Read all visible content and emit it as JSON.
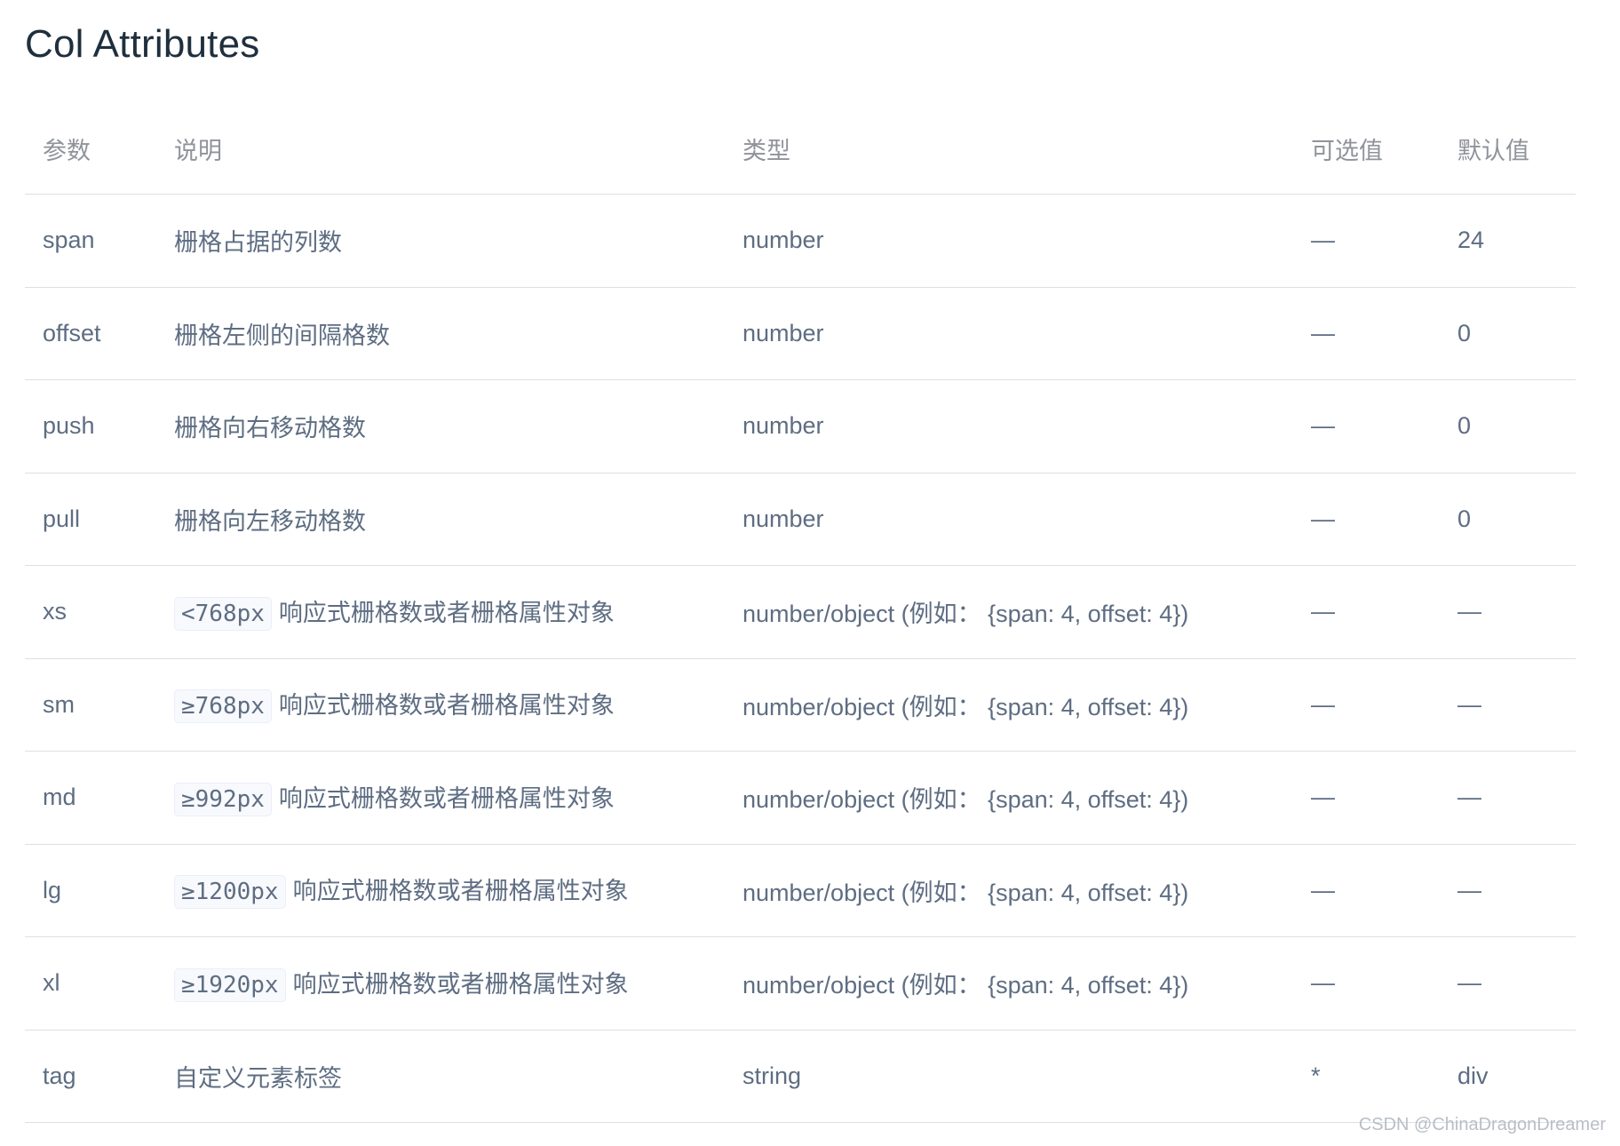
{
  "title": "Col Attributes",
  "table": {
    "headers": [
      "参数",
      "说明",
      "类型",
      "可选值",
      "默认值"
    ],
    "rows": [
      {
        "param": "span",
        "badge": "",
        "desc": "栅格占据的列数",
        "type": "number",
        "options": "—",
        "default": "24"
      },
      {
        "param": "offset",
        "badge": "",
        "desc": "栅格左侧的间隔格数",
        "type": "number",
        "options": "—",
        "default": "0"
      },
      {
        "param": "push",
        "badge": "",
        "desc": "栅格向右移动格数",
        "type": "number",
        "options": "—",
        "default": "0"
      },
      {
        "param": "pull",
        "badge": "",
        "desc": "栅格向左移动格数",
        "type": "number",
        "options": "—",
        "default": "0"
      },
      {
        "param": "xs",
        "badge": "<768px",
        "desc": "响应式栅格数或者栅格属性对象",
        "type": "number/object (例如： {span: 4, offset: 4})",
        "options": "—",
        "default": "—"
      },
      {
        "param": "sm",
        "badge": "≥768px",
        "desc": "响应式栅格数或者栅格属性对象",
        "type": "number/object (例如： {span: 4, offset: 4})",
        "options": "—",
        "default": "—"
      },
      {
        "param": "md",
        "badge": "≥992px",
        "desc": "响应式栅格数或者栅格属性对象",
        "type": "number/object (例如： {span: 4, offset: 4})",
        "options": "—",
        "default": "—"
      },
      {
        "param": "lg",
        "badge": "≥1200px",
        "desc": "响应式栅格数或者栅格属性对象",
        "type": "number/object (例如： {span: 4, offset: 4})",
        "options": "—",
        "default": "—"
      },
      {
        "param": "xl",
        "badge": "≥1920px",
        "desc": "响应式栅格数或者栅格属性对象",
        "type": "number/object (例如： {span: 4, offset: 4})",
        "options": "—",
        "default": "—"
      },
      {
        "param": "tag",
        "badge": "",
        "desc": "自定义元素标签",
        "type": "string",
        "options": "*",
        "default": "div"
      }
    ]
  },
  "watermark": "CSDN @ChinaDragonDreamer"
}
